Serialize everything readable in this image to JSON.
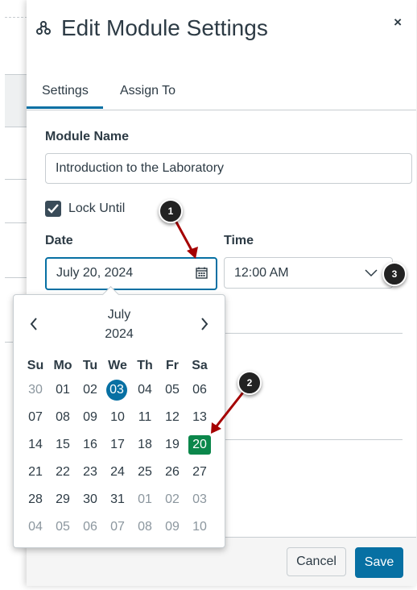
{
  "dialog": {
    "title": "Edit Module Settings",
    "close_label": "×"
  },
  "tabs": [
    {
      "label": "Settings",
      "active": true
    },
    {
      "label": "Assign To",
      "active": false
    }
  ],
  "form": {
    "module_name_label": "Module Name",
    "module_name_value": "Introduction to the Laboratory",
    "lock_until_label": "Lock Until",
    "lock_until_checked": true,
    "date_label": "Date",
    "date_value": "July 20, 2024",
    "time_label": "Time",
    "time_value": "12:00 AM"
  },
  "calendar": {
    "month": "July",
    "year": "2024",
    "prev_label": "‹",
    "next_label": "›",
    "weekdays": [
      "Su",
      "Mo",
      "Tu",
      "We",
      "Th",
      "Fr",
      "Sa"
    ],
    "weeks": [
      [
        "30",
        "01",
        "02",
        "03",
        "04",
        "05",
        "06"
      ],
      [
        "07",
        "08",
        "09",
        "10",
        "11",
        "12",
        "13"
      ],
      [
        "14",
        "15",
        "16",
        "17",
        "18",
        "19",
        "20"
      ],
      [
        "21",
        "22",
        "23",
        "24",
        "25",
        "26",
        "27"
      ],
      [
        "28",
        "29",
        "30",
        "31",
        "01",
        "02",
        "03"
      ],
      [
        "04",
        "05",
        "06",
        "07",
        "08",
        "09",
        "10"
      ]
    ],
    "today": "03",
    "selected": "20"
  },
  "footer": {
    "cancel_label": "Cancel",
    "save_label": "Save"
  },
  "callouts": [
    "1",
    "2",
    "3"
  ],
  "colors": {
    "accent": "#0770a3",
    "selected_day": "#0b874b",
    "annotation_arrow": "#a50000"
  }
}
